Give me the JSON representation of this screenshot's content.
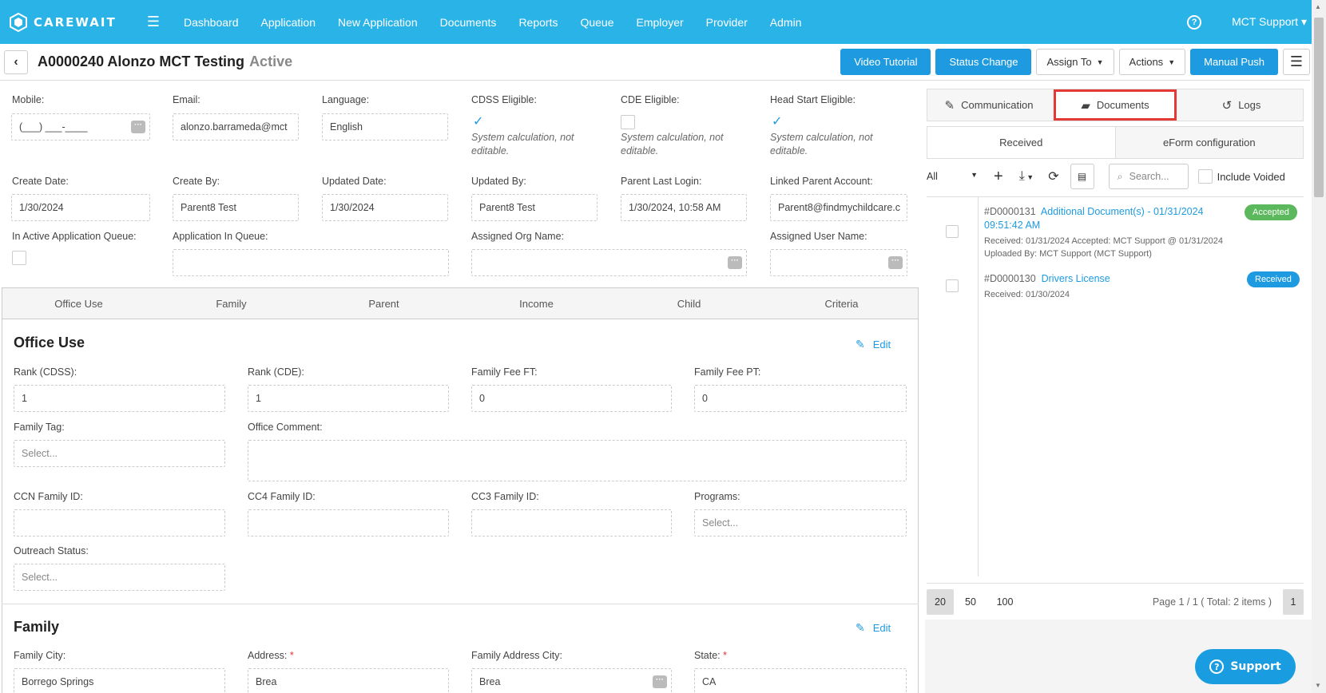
{
  "nav": {
    "brand": "CAREWAIT",
    "items": [
      "Dashboard",
      "Application",
      "New Application",
      "Documents",
      "Reports",
      "Queue",
      "Employer",
      "Provider",
      "Admin"
    ],
    "user": "MCT Support ▾"
  },
  "header": {
    "app_id": "A0000240 Alonzo MCT Testing",
    "status": "Active",
    "buttons": {
      "video": "Video Tutorial",
      "status_change": "Status Change",
      "assign_to": "Assign To",
      "actions": "Actions",
      "manual_push": "Manual Push"
    }
  },
  "fields": {
    "mobile": {
      "label": "Mobile:",
      "value": "(___) ___-____"
    },
    "email": {
      "label": "Email:",
      "value": "alonzo.barrameda@mct"
    },
    "language": {
      "label": "Language:",
      "value": "English"
    },
    "cdss": {
      "label": "CDSS Eligible:",
      "note": "System calculation, not editable."
    },
    "cde": {
      "label": "CDE Eligible:",
      "note": "System calculation, not editable."
    },
    "headstart": {
      "label": "Head Start Eligible:",
      "note": "System calculation, not editable."
    },
    "create_date": {
      "label": "Create Date:",
      "value": "1/30/2024"
    },
    "create_by": {
      "label": "Create By:",
      "value": "Parent8 Test"
    },
    "updated_date": {
      "label": "Updated Date:",
      "value": "1/30/2024"
    },
    "updated_by": {
      "label": "Updated By:",
      "value": "Parent8 Test"
    },
    "parent_login": {
      "label": "Parent Last Login:",
      "value": "1/30/2024, 10:58 AM"
    },
    "linked_parent": {
      "label": "Linked Parent Account:",
      "value": "Parent8@findmychildcare.c"
    },
    "in_queue": {
      "label": "In Active Application Queue:"
    },
    "app_in_queue": {
      "label": "Application In Queue:",
      "value": ""
    },
    "org_name": {
      "label": "Assigned Org Name:",
      "value": ""
    },
    "user_name": {
      "label": "Assigned User Name:",
      "value": ""
    }
  },
  "section_tabs": [
    "Office Use",
    "Family",
    "Parent",
    "Income",
    "Child",
    "Criteria"
  ],
  "office_use": {
    "title": "Office Use",
    "edit": "Edit",
    "rank_cdss": {
      "label": "Rank (CDSS):",
      "value": "1"
    },
    "rank_cde": {
      "label": "Rank (CDE):",
      "value": "1"
    },
    "fee_ft": {
      "label": "Family Fee FT:",
      "value": "0"
    },
    "fee_pt": {
      "label": "Family Fee PT:",
      "value": "0"
    },
    "family_tag": {
      "label": "Family Tag:",
      "placeholder": "Select..."
    },
    "office_comment": {
      "label": "Office Comment:",
      "value": ""
    },
    "ccn": {
      "label": "CCN Family ID:",
      "value": ""
    },
    "cc4": {
      "label": "CC4 Family ID:",
      "value": ""
    },
    "cc3": {
      "label": "CC3 Family ID:",
      "value": ""
    },
    "programs": {
      "label": "Programs:",
      "placeholder": "Select..."
    },
    "outreach": {
      "label": "Outreach Status:",
      "placeholder": "Select..."
    }
  },
  "family": {
    "title": "Family",
    "edit": "Edit",
    "city": {
      "label": "Family City:",
      "value": "Borrego Springs"
    },
    "address": {
      "label": "Address:",
      "value": "Brea"
    },
    "address_city": {
      "label": "Family Address City:",
      "value": "Brea"
    },
    "state": {
      "label": "State:",
      "value": "CA"
    }
  },
  "right_panel": {
    "tabs": [
      "Communication",
      "Documents",
      "Logs"
    ],
    "subtabs": [
      "Received",
      "eForm configuration"
    ],
    "filter": "All",
    "search_placeholder": "Search...",
    "include_voided": "Include Voided",
    "documents": [
      {
        "id": "#D0000131",
        "title": "Additional Document(s) - 01/31/2024 09:51:42 AM",
        "meta1": "Received: 01/31/2024 Accepted: MCT Support @ 01/31/2024",
        "meta2": "Uploaded By: MCT Support (MCT Support)",
        "status": "Accepted"
      },
      {
        "id": "#D0000130",
        "title": "Drivers License",
        "meta1": "Received: 01/30/2024",
        "status": "Received"
      }
    ],
    "pager": {
      "sizes": [
        "20",
        "50",
        "100"
      ],
      "info": "Page 1 / 1 ( Total: 2 items )",
      "page": "1"
    }
  },
  "support_label": "Support",
  "colors": {
    "brand": "#2ab3e6",
    "primary": "#1e9be0",
    "accepted": "#5cb85c",
    "highlight": "#e53935"
  }
}
